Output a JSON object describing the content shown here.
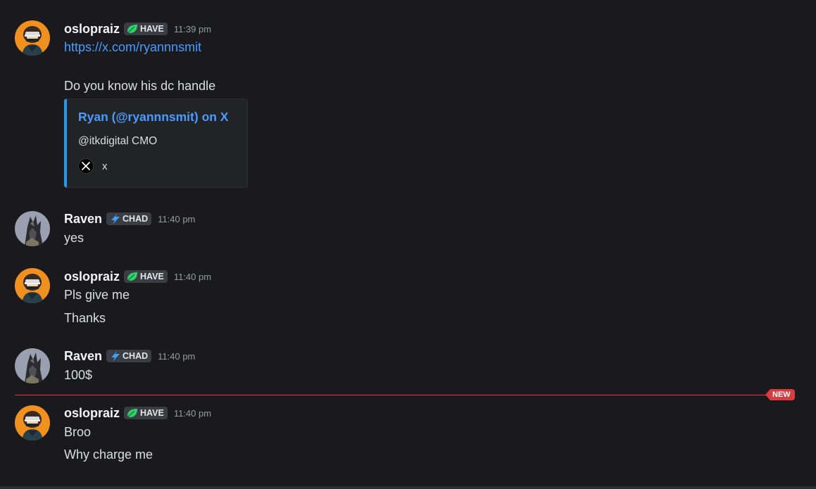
{
  "messages": [
    {
      "author": "oslopraiz",
      "tag": "HAVE",
      "time": "11:39 pm",
      "link": "https://x.com/ryannnsmit",
      "text": "Do you know his dc handle",
      "embed": {
        "title": "Ryan (@ryannnsmit) on X",
        "description": "@itkdigital CMO",
        "footer": "x"
      }
    },
    {
      "author": "Raven",
      "tag": "CHAD",
      "time": "11:40 pm",
      "lines": [
        "yes"
      ]
    },
    {
      "author": "oslopraiz",
      "tag": "HAVE",
      "time": "11:40 pm",
      "lines": [
        "Pls give me",
        "Thanks"
      ]
    },
    {
      "author": "Raven",
      "tag": "CHAD",
      "time": "11:40 pm",
      "lines": [
        "100$"
      ]
    },
    {
      "author": "oslopraiz",
      "tag": "HAVE",
      "time": "11:40 pm",
      "lines": [
        "Broo",
        "Why charge me"
      ]
    }
  ],
  "new_divider": {
    "label": "NEW"
  },
  "colors": {
    "background": "#1a1a1e",
    "link": "#4a9bff",
    "new_marker": "#d83c3e",
    "embed_accent": "#1d9bf0"
  },
  "icons": {
    "have_tag": "leaf-icon",
    "chad_tag": "lightning-icon",
    "embed_footer": "x-logo-icon"
  }
}
